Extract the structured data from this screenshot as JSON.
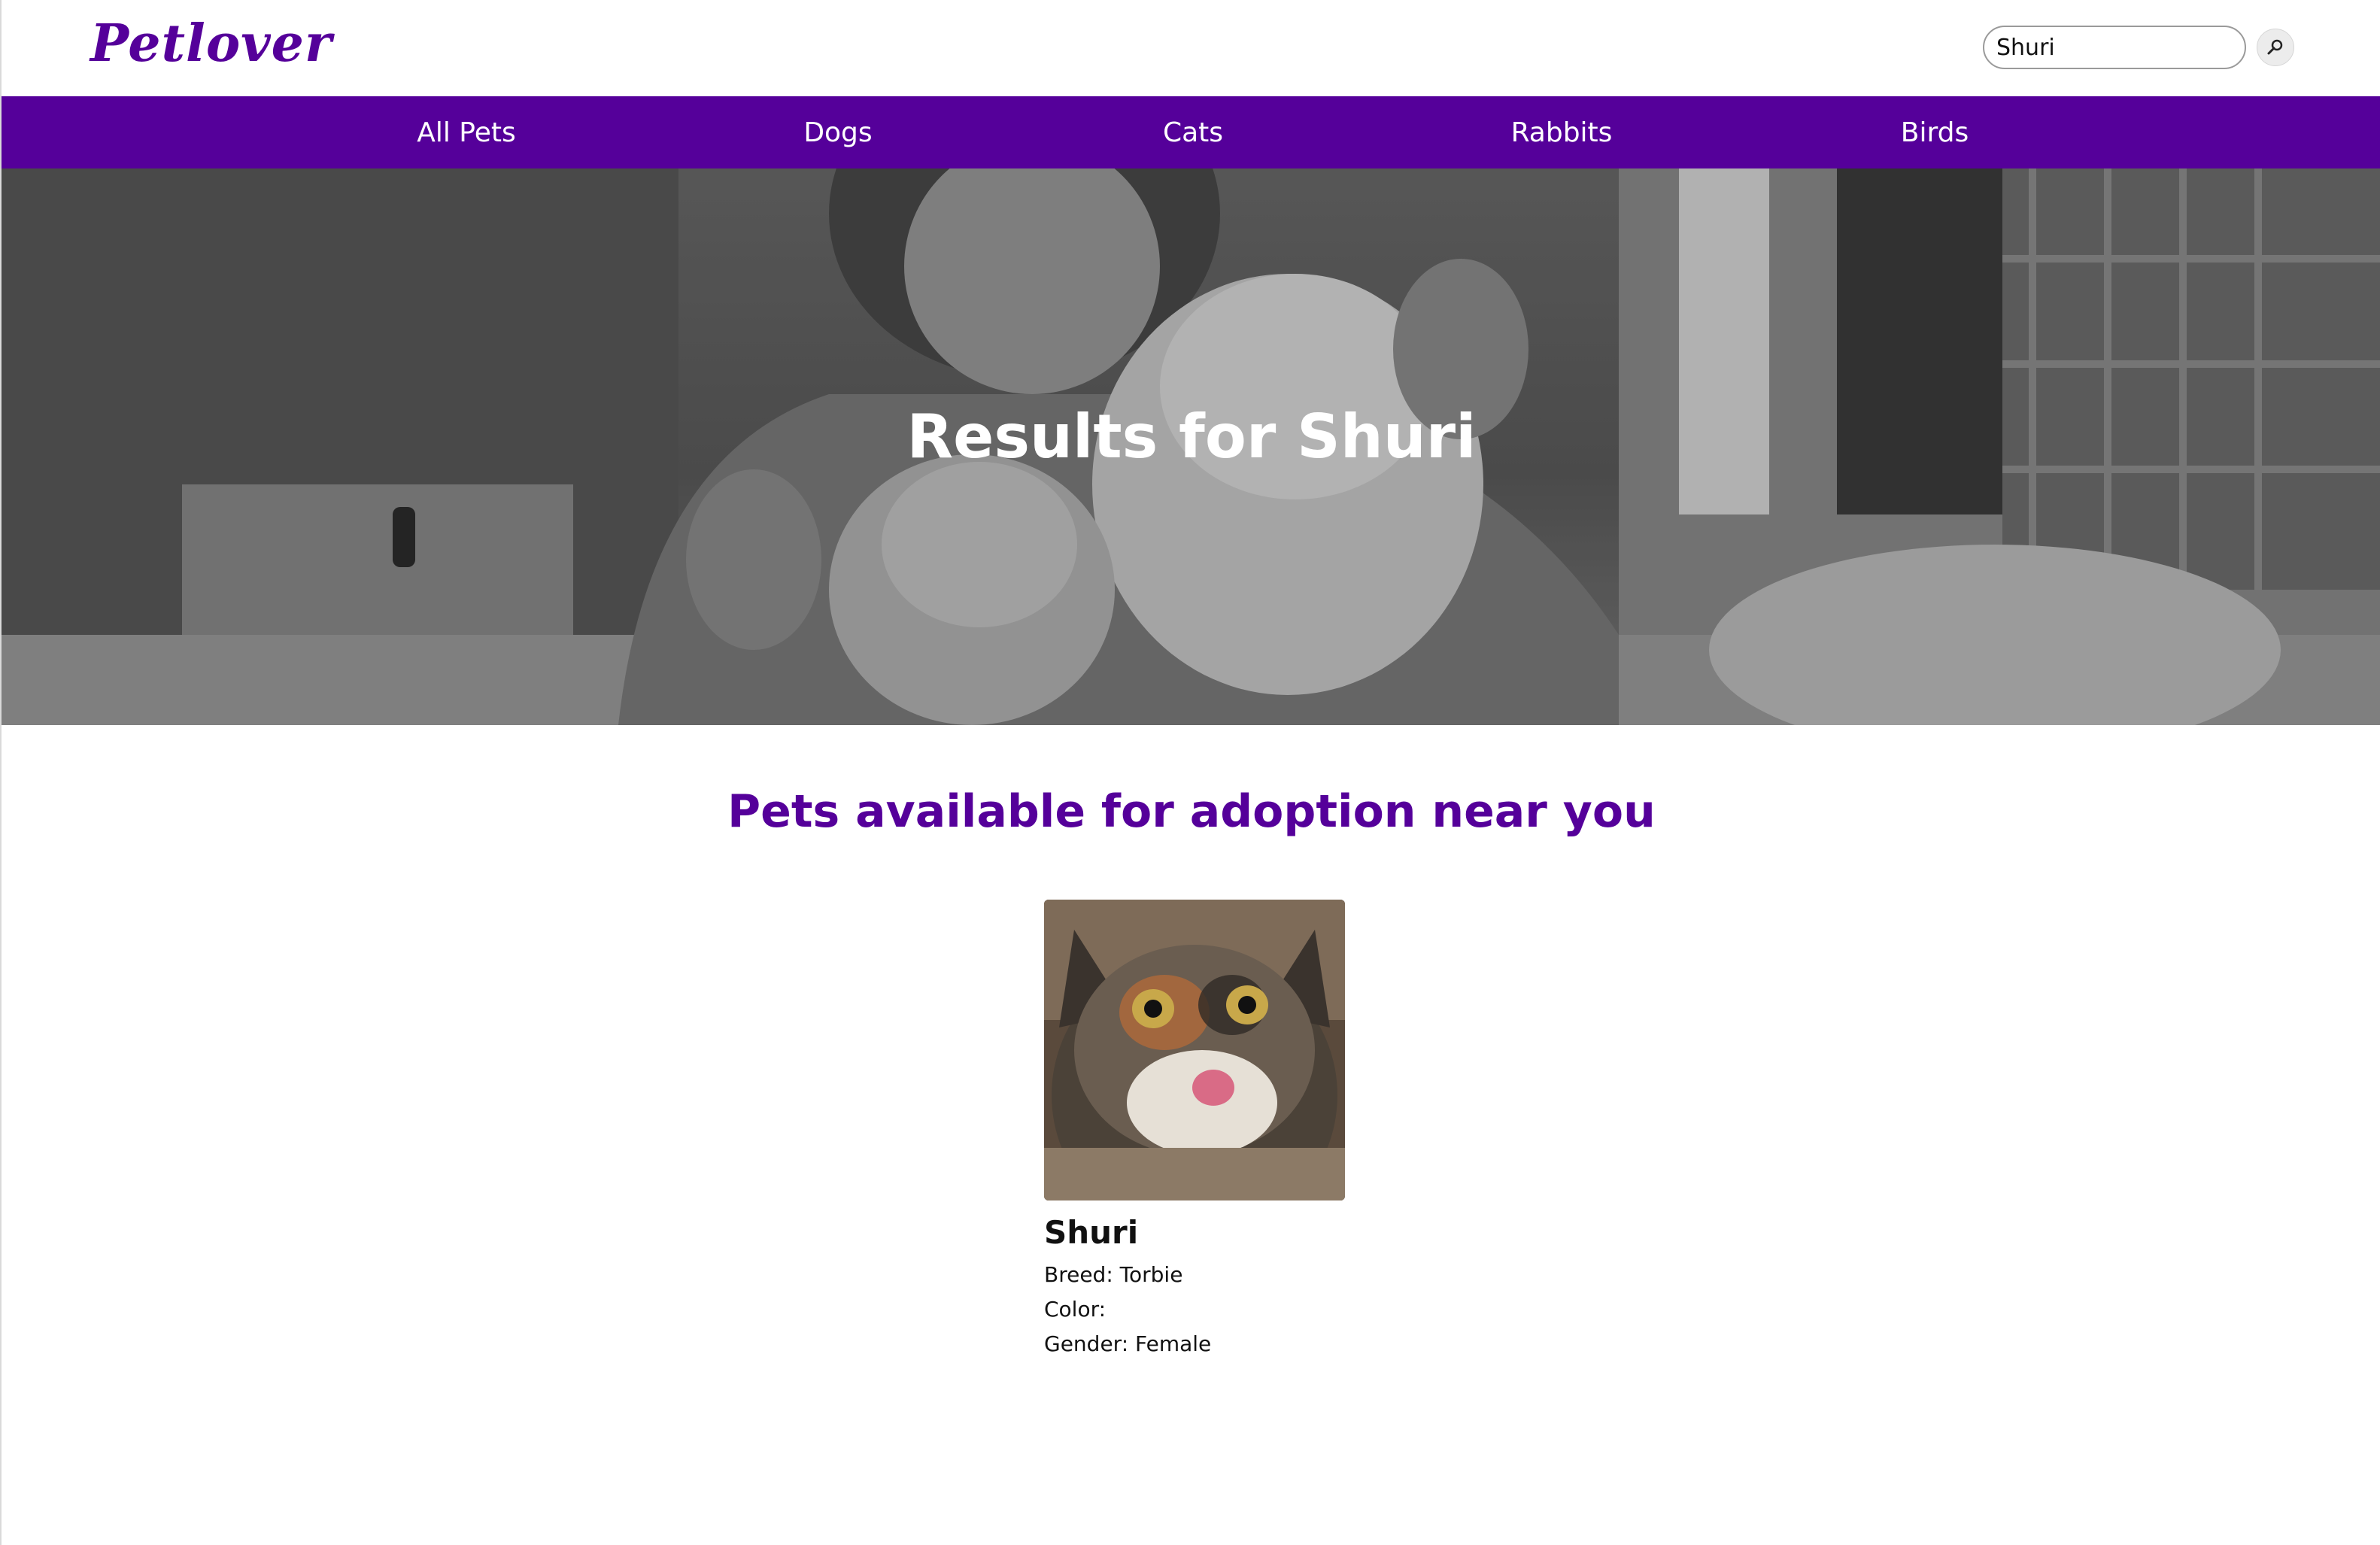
{
  "brand": {
    "name": "Petlover",
    "color": "#55009a"
  },
  "search": {
    "value": "Shuri",
    "button_icon": "magnifier-icon"
  },
  "nav": {
    "background": "#55009a",
    "items": [
      {
        "label": "All Pets"
      },
      {
        "label": "Dogs"
      },
      {
        "label": "Cats"
      },
      {
        "label": "Rabbits"
      },
      {
        "label": "Birds"
      }
    ]
  },
  "hero": {
    "title": "Results for Shuri"
  },
  "listing": {
    "title": "Pets available for adoption near you",
    "pets": [
      {
        "name": "Shuri",
        "breed": "Breed: Torbie",
        "color": "Color:",
        "gender": "Gender: Female"
      }
    ]
  }
}
